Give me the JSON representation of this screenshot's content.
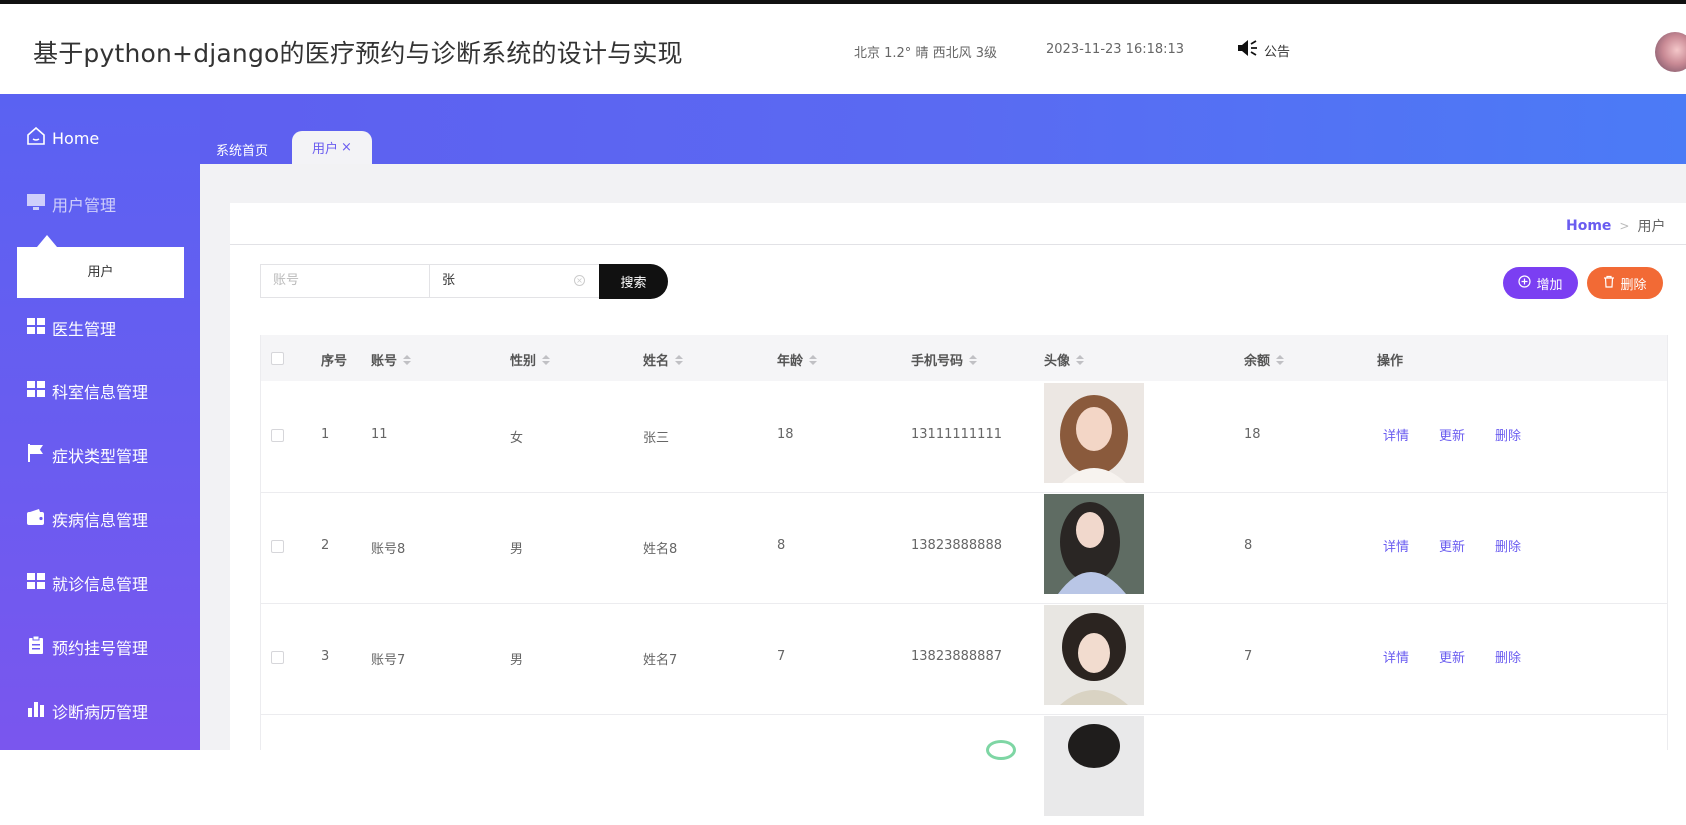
{
  "header": {
    "title": "基于python+django的医疗预约与诊断系统的设计与实现",
    "weather": "北京  1.2°  晴  西北风  3级",
    "datetime": "2023-11-23 16:18:13",
    "notice_label": "公告"
  },
  "sidebar": {
    "home_label": "Home",
    "user_mgmt_label": "用户管理",
    "user_sub_label": "用户",
    "items": [
      "医生管理",
      "科室信息管理",
      "症状类型管理",
      "疾病信息管理",
      "就诊信息管理",
      "预约挂号管理",
      "诊断病历管理"
    ]
  },
  "tabs": {
    "home_label": "系统首页",
    "active_label": "用户",
    "close_symbol": "×"
  },
  "breadcrumb": {
    "home": "Home",
    "sep": ">",
    "current": "用户"
  },
  "search": {
    "account_placeholder": "账号",
    "name_value": "张",
    "search_label": "搜索",
    "add_label": "增加",
    "delete_label": "删除"
  },
  "table": {
    "columns": {
      "index": "序号",
      "account": "账号",
      "gender": "性别",
      "name": "姓名",
      "age": "年龄",
      "phone": "手机号码",
      "avatar": "头像",
      "balance": "余额",
      "actions": "操作"
    },
    "action_labels": {
      "detail": "详情",
      "update": "更新",
      "delete": "删除"
    },
    "rows": [
      {
        "index": "1",
        "account": "11",
        "gender": "女",
        "name": "张三",
        "age": "18",
        "phone": "13111111111",
        "balance": "18"
      },
      {
        "index": "2",
        "account": "账号8",
        "gender": "男",
        "name": "姓名8",
        "age": "8",
        "phone": "13823888888",
        "balance": "8"
      },
      {
        "index": "3",
        "account": "账号7",
        "gender": "男",
        "name": "姓名7",
        "age": "7",
        "phone": "13823888887",
        "balance": "7"
      }
    ]
  },
  "colors": {
    "accent": "#6a5cf0",
    "sidebar_top": "#5a62f2",
    "add_button": "#7b3ff2",
    "delete_button": "#f26a35"
  }
}
